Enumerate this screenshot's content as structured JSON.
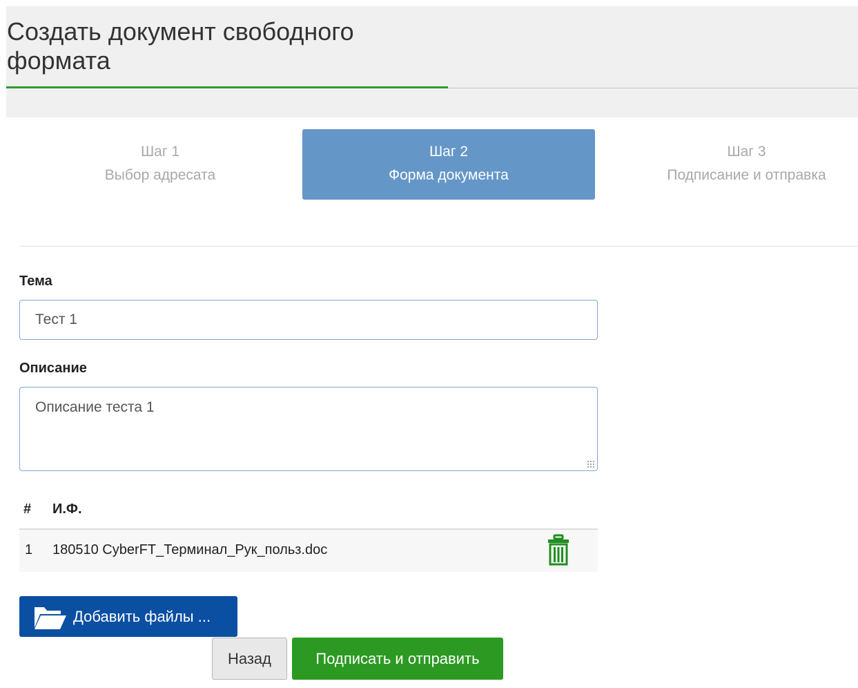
{
  "page": {
    "title": "Создать документ свободного формата"
  },
  "steps": [
    {
      "number": "Шаг 1",
      "title": "Выбор адресата",
      "active": false
    },
    {
      "number": "Шаг 2",
      "title": "Форма документа",
      "active": true
    },
    {
      "number": "Шаг 3",
      "title": "Подписание и отправка",
      "active": false
    }
  ],
  "form": {
    "subject_label": "Тема",
    "subject_value": "Тест 1",
    "description_label": "Описание",
    "description_value": "Описание теста 1"
  },
  "files_table": {
    "headers": [
      "#",
      "И.Ф."
    ],
    "rows": [
      {
        "index": "1",
        "name": "180510 CyberFT_Терминал_Рук_польз.doc",
        "action_icon": "trash-icon"
      }
    ]
  },
  "buttons": {
    "add_files": "Добавить файлы ...",
    "back": "Назад",
    "sign_send": "Подписать и отправить"
  },
  "colors": {
    "active_step": "#6596c8",
    "accent_green": "#2c9a22",
    "add_button": "#0a4fa2",
    "header_underline": "#2e9a2e"
  }
}
